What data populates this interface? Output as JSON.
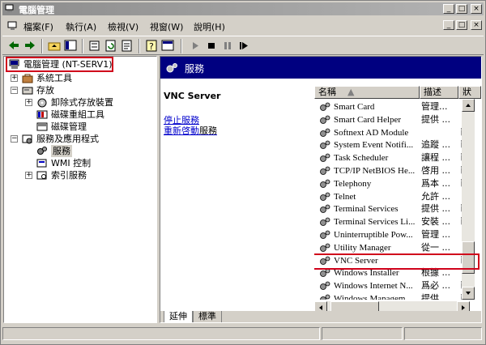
{
  "window": {
    "title": "電腦管理",
    "min_label": "_",
    "max_label": "□",
    "close_label": "×"
  },
  "menu": {
    "items": [
      "檔案(F)",
      "執行(A)",
      "檢視(V)",
      "視窗(W)",
      "說明(H)"
    ],
    "mdi_min": "_",
    "mdi_restore": "□",
    "mdi_close": "×"
  },
  "tree": {
    "root": "電腦管理 (NT-SERV1)",
    "system_tools": "系統工具",
    "storage": "存放",
    "removable": "卸除式存放裝置",
    "defrag": "磁碟重組工具",
    "disk_mgmt": "磁碟管理",
    "services_apps": "服務及應用程式",
    "services": "服務",
    "wmi": "WMI 控制",
    "indexing": "索引服務"
  },
  "pane": {
    "header": "服務",
    "selected_service": "VNC Server",
    "stop_link": "停止服務",
    "restart_link": "重新啓動",
    "restart_suffix": "服務"
  },
  "list": {
    "columns": [
      "名稱",
      "描述",
      "狀"
    ],
    "rows": [
      {
        "name": "Smart Card",
        "desc": "管理...",
        "status": ""
      },
      {
        "name": "Smart Card Helper",
        "desc": "提供 ...",
        "status": ""
      },
      {
        "name": "Softnext AD Module",
        "desc": "",
        "status": "已"
      },
      {
        "name": "System Event Notifi...",
        "desc": "追蹤 ...",
        "status": "已"
      },
      {
        "name": "Task Scheduler",
        "desc": "讓程 ...",
        "status": "已"
      },
      {
        "name": "TCP/IP NetBIOS He...",
        "desc": "啓用 ...",
        "status": "已"
      },
      {
        "name": "Telephony",
        "desc": "爲本 ...",
        "status": "已"
      },
      {
        "name": "Telnet",
        "desc": "允許 ...",
        "status": ""
      },
      {
        "name": "Terminal Services",
        "desc": "提供 ...",
        "status": "已"
      },
      {
        "name": "Terminal Services Li...",
        "desc": "安裝 ...",
        "status": "已"
      },
      {
        "name": "Uninterruptible Pow...",
        "desc": "管理 ...",
        "status": ""
      },
      {
        "name": "Utility Manager",
        "desc": "從一 ...",
        "status": ""
      },
      {
        "name": "VNC Server",
        "desc": "",
        "status": "已"
      },
      {
        "name": "Windows Installer",
        "desc": "根據 ...",
        "status": ""
      },
      {
        "name": "Windows Internet N...",
        "desc": "爲必 ...",
        "status": "已"
      },
      {
        "name": "Windows Managem...",
        "desc": "提供 ...",
        "status": "已"
      }
    ]
  },
  "tabs": [
    "延伸",
    "標準"
  ],
  "colors": {
    "header_bg": "#000080",
    "highlight": "#d0021b",
    "link": "#0000cc"
  }
}
